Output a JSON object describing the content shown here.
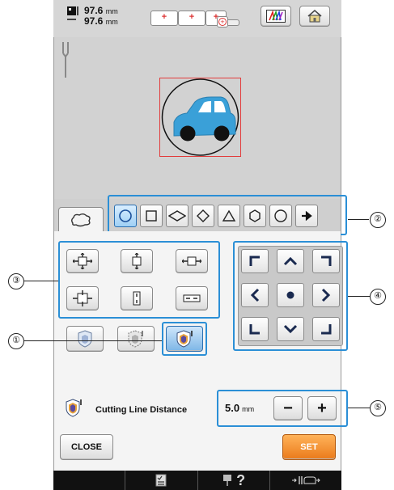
{
  "header": {
    "width_value": "97.6",
    "height_value": "97.6",
    "unit": "mm"
  },
  "shapes": {
    "items": [
      "circle",
      "square",
      "diamond-wide",
      "diamond",
      "triangle",
      "hexagon",
      "octagon",
      "arrow"
    ]
  },
  "distance": {
    "label": "Cutting Line Distance",
    "value": "5.0",
    "unit": "mm",
    "minus": "−",
    "plus": "+"
  },
  "buttons": {
    "close": "CLOSE",
    "set": "SET"
  },
  "callouts": {
    "c1": "①",
    "c2": "②",
    "c3": "③",
    "c4": "④",
    "c5": "⑤"
  },
  "colors": {
    "highlight": "#2b8fd6",
    "set_button": "#f08a2c",
    "car_body": "#3aa0d8"
  },
  "bottombar": {
    "help_symbol": "?"
  }
}
